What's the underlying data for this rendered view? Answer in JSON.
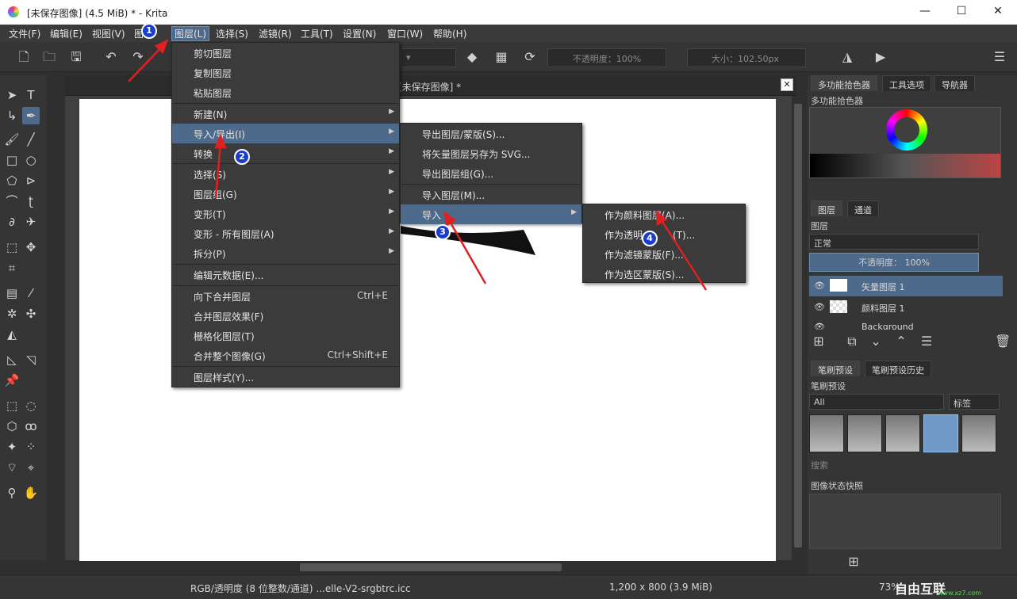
{
  "window": {
    "title": "[未保存图像]  (4.5 MiB)  * - Krita",
    "minimize": "—",
    "maximize": "☐",
    "close": "✕"
  },
  "menubar": [
    "文件(F)",
    "编辑(E)",
    "视图(V)",
    "图",
    "图层(L)",
    "选择(S)",
    "滤镜(R)",
    "工具(T)",
    "设置(N)",
    "窗口(W)",
    "帮助(H)"
  ],
  "toolbar": {
    "opacity_label": "不透明度：100%",
    "size_label": "大小：",
    "size_value": "102.50px"
  },
  "document": {
    "tab_title": "[未保存图像]  *",
    "close": "✕"
  },
  "layer_menu": {
    "items": [
      {
        "label": "剪切图层",
        "shortcut": "",
        "submenu": false
      },
      {
        "label": "复制图层",
        "shortcut": "",
        "submenu": false
      },
      {
        "label": "粘贴图层",
        "shortcut": "",
        "submenu": false
      },
      {
        "label": "新建(N)",
        "shortcut": "",
        "submenu": true
      },
      {
        "label": "导入/导出(I)",
        "shortcut": "",
        "submenu": true
      },
      {
        "label": "转换",
        "shortcut": "",
        "submenu": true
      },
      {
        "label": "选择(S)",
        "shortcut": "",
        "submenu": true
      },
      {
        "label": "图层组(G)",
        "shortcut": "",
        "submenu": true
      },
      {
        "label": "变形(T)",
        "shortcut": "",
        "submenu": true
      },
      {
        "label": "变形 - 所有图层(A)",
        "shortcut": "",
        "submenu": true
      },
      {
        "label": "拆分(P)",
        "shortcut": "",
        "submenu": true
      },
      {
        "label": "编辑元数据(E)...",
        "shortcut": "",
        "submenu": false
      },
      {
        "label": "向下合并图层",
        "shortcut": "Ctrl+E",
        "submenu": false
      },
      {
        "label": "合并图层效果(F)",
        "shortcut": "",
        "submenu": false
      },
      {
        "label": "栅格化图层(T)",
        "shortcut": "",
        "submenu": false
      },
      {
        "label": "合并整个图像(G)",
        "shortcut": "Ctrl+Shift+E",
        "submenu": false
      },
      {
        "label": "图层样式(Y)...",
        "shortcut": "",
        "submenu": false
      }
    ]
  },
  "import_export_menu": {
    "items": [
      {
        "label": "导出图层/蒙版(S)...",
        "submenu": false
      },
      {
        "label": "将矢量图层另存为 SVG...",
        "submenu": false
      },
      {
        "label": "导出图层组(G)...",
        "submenu": false
      },
      {
        "label": "导入图层(M)...",
        "submenu": false
      },
      {
        "label": "导入",
        "submenu": true
      }
    ]
  },
  "import_menu": {
    "items": [
      {
        "label": "作为颜料图层(A)..."
      },
      {
        "label": "作为透明"
      },
      {
        "label": "作为滤镜蒙版(F)..."
      },
      {
        "label": "作为选区蒙版(S)..."
      }
    ],
    "item2_tail": "(T)..."
  },
  "annotations": {
    "b1": "1",
    "b2": "2",
    "b3": "3",
    "b4": "4"
  },
  "dock": {
    "tabs_top": [
      "多功能拾色器",
      "工具选项",
      "导航器"
    ],
    "color_selector_title": "多功能拾色器",
    "layer_tabs": [
      "图层",
      "通道"
    ],
    "layers_title": "图层",
    "blend_mode": "正常",
    "opacity": "不透明度：  100%",
    "layers": [
      {
        "name": "矢量图层  1",
        "selected": true
      },
      {
        "name": "颜料图层  1",
        "selected": false
      },
      {
        "name": "Background",
        "selected": false
      }
    ],
    "brush_tabs": [
      "笔刷预设",
      "笔刷预设历史"
    ],
    "brush_title": "笔刷预设",
    "brush_filter": "All",
    "brush_tag": "标签",
    "search_placeholder": "搜索",
    "snapshot_title": "图像状态快照"
  },
  "status": {
    "color_info": "RGB/透明度 (8 位整数/通道)  ...elle-V2-srgbtrc.icc",
    "dimensions": "1,200 x 800 (3.9 MiB)",
    "zoom": "73%"
  },
  "watermark": "自由互联",
  "watermark_url": "www.xz7.com"
}
